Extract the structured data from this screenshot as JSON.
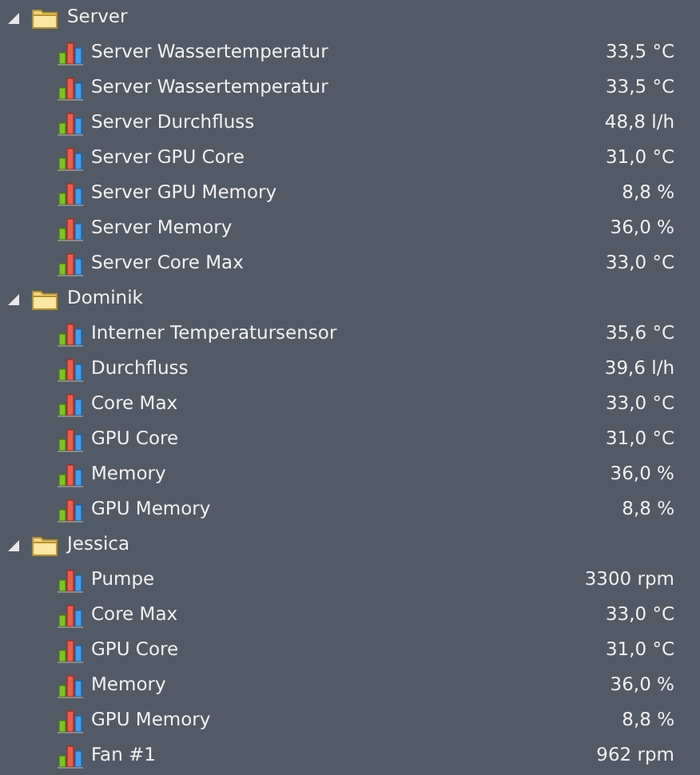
{
  "groups": [
    {
      "name": "Server",
      "expanded": true,
      "children": [
        {
          "name": "Server Wassertemperatur",
          "value": "33,5 °C"
        },
        {
          "name": "Server Wassertemperatur",
          "value": "33,5 °C"
        },
        {
          "name": "Server Durchfluss",
          "value": "48,8 l/h"
        },
        {
          "name": "Server GPU Core",
          "value": "31,0 °C"
        },
        {
          "name": "Server GPU Memory",
          "value": "8,8 %"
        },
        {
          "name": "Server Memory",
          "value": "36,0 %"
        },
        {
          "name": "Server Core Max",
          "value": "33,0 °C"
        }
      ]
    },
    {
      "name": "Dominik",
      "expanded": true,
      "children": [
        {
          "name": "Interner Temperatursensor",
          "value": "35,6 °C"
        },
        {
          "name": "Durchfluss",
          "value": "39,6 l/h"
        },
        {
          "name": "Core Max",
          "value": "33,0 °C"
        },
        {
          "name": "GPU Core",
          "value": "31,0 °C"
        },
        {
          "name": "Memory",
          "value": "36,0 %"
        },
        {
          "name": "GPU Memory",
          "value": "8,8 %"
        }
      ]
    },
    {
      "name": "Jessica",
      "expanded": true,
      "children": [
        {
          "name": "Pumpe",
          "value": "3300 rpm"
        },
        {
          "name": "Core Max",
          "value": "33,0 °C"
        },
        {
          "name": "GPU Core",
          "value": "31,0 °C"
        },
        {
          "name": "Memory",
          "value": "36,0 %"
        },
        {
          "name": "GPU Memory",
          "value": "8,8 %"
        },
        {
          "name": "Fan #1",
          "value": "962 rpm"
        }
      ]
    }
  ]
}
